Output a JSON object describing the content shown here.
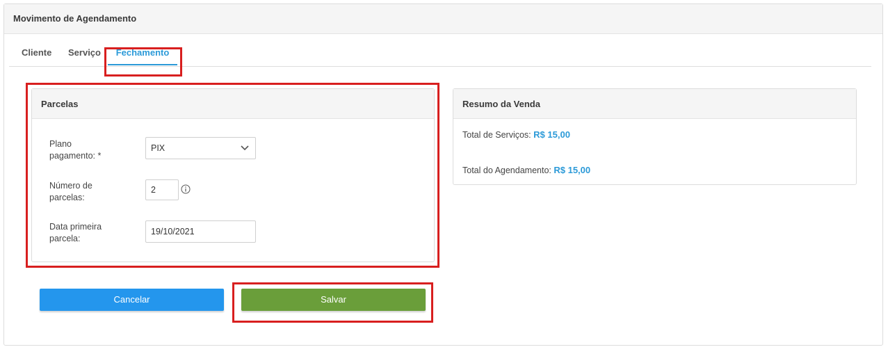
{
  "page": {
    "title": "Movimento de Agendamento"
  },
  "tabs": [
    {
      "label": "Cliente",
      "active": false
    },
    {
      "label": "Serviço",
      "active": false
    },
    {
      "label": "Fechamento",
      "active": true
    }
  ],
  "parcelas": {
    "title": "Parcelas",
    "plano_label_line1": "Plano",
    "plano_label_line2": "pagamento: *",
    "plano_value": "PIX",
    "numero_label_line1": "Número de",
    "numero_label_line2": "parcelas:",
    "numero_value": "2",
    "data_label_line1": "Data primeira",
    "data_label_line2": "parcela:",
    "data_value": "19/10/2021"
  },
  "resumo": {
    "title": "Resumo da Venda",
    "servicos_label": "Total de Serviços:",
    "servicos_value": "R$ 15,00",
    "agendamento_label": "Total do Agendamento:",
    "agendamento_value": "R$ 15,00"
  },
  "buttons": {
    "cancel_label": "Cancelar",
    "save_label": "Salvar"
  },
  "colors": {
    "accent": "#2c9ad8",
    "cancel": "#2496ed",
    "save": "#6a9e3a",
    "highlight": "#d81f1f"
  },
  "icons": {
    "plano_dropdown": "chevron-down-icon",
    "numero_info": "info-icon"
  }
}
